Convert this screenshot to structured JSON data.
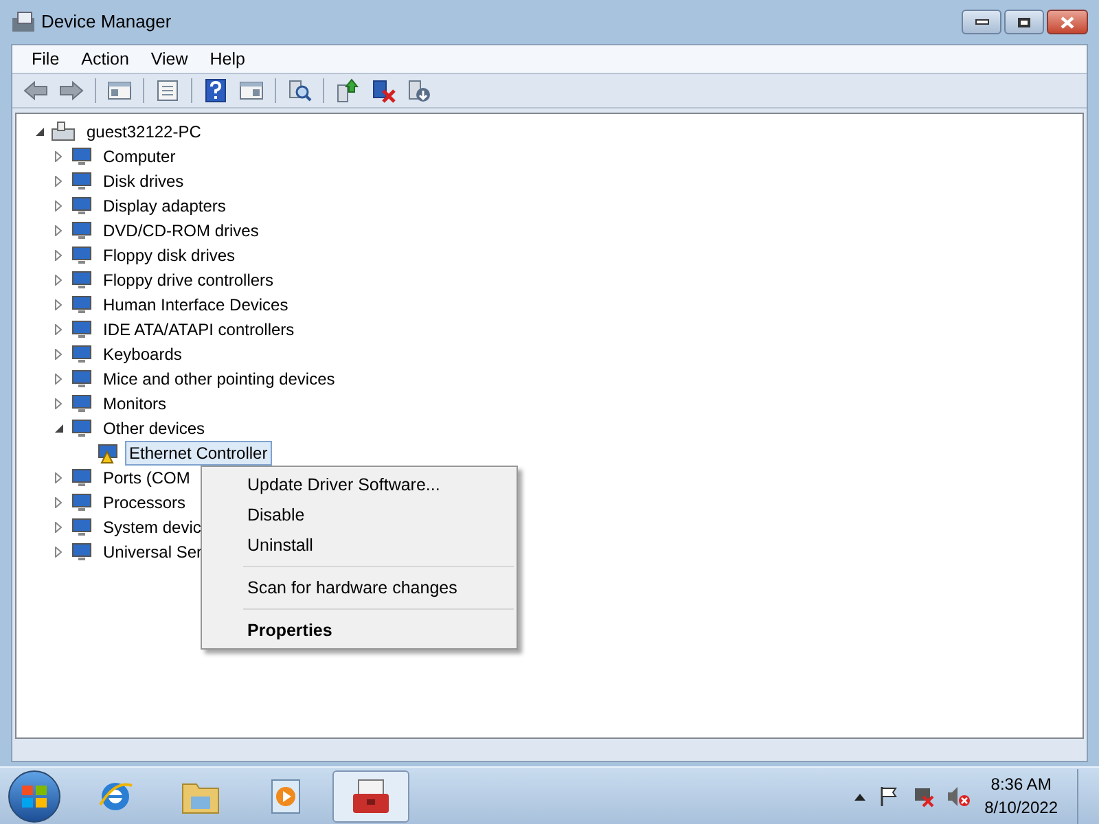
{
  "window": {
    "title": "Device Manager"
  },
  "menu_bar": [
    "File",
    "Action",
    "View",
    "Help"
  ],
  "toolbar": [
    {
      "kind": "back"
    },
    {
      "kind": "forward"
    },
    {
      "kind": "separator"
    },
    {
      "kind": "console_tree"
    },
    {
      "kind": "separator"
    },
    {
      "kind": "properties"
    },
    {
      "kind": "separator"
    },
    {
      "kind": "help"
    },
    {
      "kind": "action_pane"
    },
    {
      "kind": "separator"
    },
    {
      "kind": "scan"
    },
    {
      "kind": "separator"
    },
    {
      "kind": "update"
    },
    {
      "kind": "uninstall"
    },
    {
      "kind": "disable"
    }
  ],
  "tree": {
    "label": "guest32122-PC",
    "expanded": true,
    "children": [
      {
        "label": "Computer",
        "expanded": false,
        "selected": false
      },
      {
        "label": "Disk drives",
        "expanded": false,
        "selected": false
      },
      {
        "label": "Display adapters",
        "expanded": false,
        "selected": false
      },
      {
        "label": "DVD/CD-ROM drives",
        "expanded": false,
        "selected": false
      },
      {
        "label": "Floppy disk drives",
        "expanded": false,
        "selected": false
      },
      {
        "label": "Floppy drive controllers",
        "expanded": false,
        "selected": false
      },
      {
        "label": "Human Interface Devices",
        "expanded": false,
        "selected": false
      },
      {
        "label": "IDE ATA/ATAPI controllers",
        "expanded": false,
        "selected": false
      },
      {
        "label": "Keyboards",
        "expanded": false,
        "selected": false
      },
      {
        "label": "Mice and other pointing devices",
        "expanded": false,
        "selected": false
      },
      {
        "label": "Monitors",
        "expanded": false,
        "selected": false
      },
      {
        "label": "Other devices",
        "expanded": true,
        "selected": false,
        "children": [
          {
            "label": "Ethernet Controller",
            "selected": true,
            "warning": true
          }
        ]
      },
      {
        "label": "Ports (COM",
        "expanded": false,
        "selected": false
      },
      {
        "label": "Processors",
        "expanded": false,
        "selected": false
      },
      {
        "label": "System devic",
        "expanded": false,
        "selected": false
      },
      {
        "label": "Universal Ser",
        "expanded": false,
        "selected": false
      }
    ]
  },
  "context_menu": [
    {
      "kind": "item",
      "label": "Update Driver Software...",
      "bold": false
    },
    {
      "kind": "item",
      "label": "Disable",
      "bold": false
    },
    {
      "kind": "item",
      "label": "Uninstall",
      "bold": false
    },
    {
      "kind": "separator"
    },
    {
      "kind": "item",
      "label": "Scan for hardware changes",
      "bold": false
    },
    {
      "kind": "separator"
    },
    {
      "kind": "item",
      "label": "Properties",
      "bold": true
    }
  ],
  "taskbar": {
    "apps": [
      {
        "kind": "browser",
        "selected": false
      },
      {
        "kind": "folder",
        "selected": false
      },
      {
        "kind": "media",
        "selected": false
      },
      {
        "kind": "toolbox",
        "selected": true
      }
    ],
    "clock": {
      "time": "8:36 AM",
      "date": "8/10/2022"
    }
  }
}
